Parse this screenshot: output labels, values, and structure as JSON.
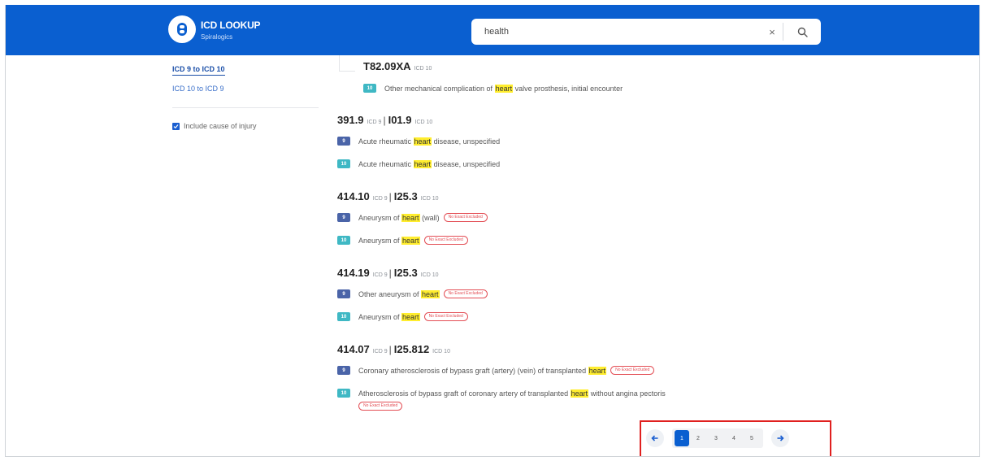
{
  "header": {
    "logo_title": "ICD LOOKUP",
    "logo_subtitle": "Spiralogics"
  },
  "search": {
    "value": "health",
    "clear_symbol": "×",
    "search_icon": "search-icon"
  },
  "sidebar": {
    "links": [
      {
        "label": "ICD 9 to ICD 10",
        "active": true
      },
      {
        "label": "ICD 10 to ICD 9",
        "active": false
      }
    ],
    "checkbox": {
      "label": "Include cause of injury",
      "checked": true
    }
  },
  "results": {
    "top_entry": {
      "code": "T82.09XA",
      "tag": "ICD 10",
      "badge": "10",
      "desc_pre": "Other mechanical complication of",
      "highlight": "heart",
      "desc_post": "valve prosthesis, initial encounter"
    },
    "groups": [
      {
        "icd9": "391.9",
        "icd9_tag": "ICD 9",
        "sep": "|",
        "icd10": "I01.9",
        "icd10_tag": "ICD 10",
        "rows": [
          {
            "badge": "9",
            "pre": "Acute rheumatic",
            "hl": "heart",
            "post": "disease, unspecified",
            "pill": ""
          },
          {
            "badge": "10",
            "pre": "Acute rheumatic",
            "hl": "heart",
            "post": "disease, unspecified",
            "pill": ""
          }
        ]
      },
      {
        "icd9": "414.10",
        "icd9_tag": "ICD 9",
        "sep": "|",
        "icd10": "I25.3",
        "icd10_tag": "ICD 10",
        "rows": [
          {
            "badge": "9",
            "pre": "Aneurysm of",
            "hl": "heart",
            "post": "(wall)",
            "pill": "No Exact Excluded"
          },
          {
            "badge": "10",
            "pre": "Aneurysm of",
            "hl": "heart",
            "post": "",
            "pill": "No Exact Excluded"
          }
        ]
      },
      {
        "icd9": "414.19",
        "icd9_tag": "ICD 9",
        "sep": "|",
        "icd10": "I25.3",
        "icd10_tag": "ICD 10",
        "rows": [
          {
            "badge": "9",
            "pre": "Other aneurysm of",
            "hl": "heart",
            "post": "",
            "pill": "No Exact Excluded"
          },
          {
            "badge": "10",
            "pre": "Aneurysm of",
            "hl": "heart",
            "post": "",
            "pill": "No Exact Excluded"
          }
        ]
      },
      {
        "icd9": "414.07",
        "icd9_tag": "ICD 9",
        "sep": "|",
        "icd10": "I25.812",
        "icd10_tag": "ICD 10",
        "rows": [
          {
            "badge": "9",
            "pre": "Coronary atherosclerosis of bypass graft (artery) (vein) of transplanted",
            "hl": "heart",
            "post": "",
            "pill": "No Exact Excluded"
          },
          {
            "badge": "10",
            "pre": "Atherosclerosis of bypass graft of coronary artery of transplanted",
            "hl": "heart",
            "post": "without angina pectoris",
            "pill": "No Exact Excluded"
          }
        ]
      }
    ]
  },
  "pagination": {
    "prev_icon": "arrow-left-icon",
    "next_icon": "arrow-right-icon",
    "pages": [
      "1",
      "2",
      "3",
      "4",
      "5"
    ],
    "current": "1"
  },
  "colors": {
    "header_blue": "#0a5fd0",
    "highlight": "#ffed2e",
    "icd9_badge": "#4a64a8",
    "icd10_badge": "#3fb8c4",
    "exclusion_red": "#e34e55",
    "callout_red": "#e0201f"
  }
}
